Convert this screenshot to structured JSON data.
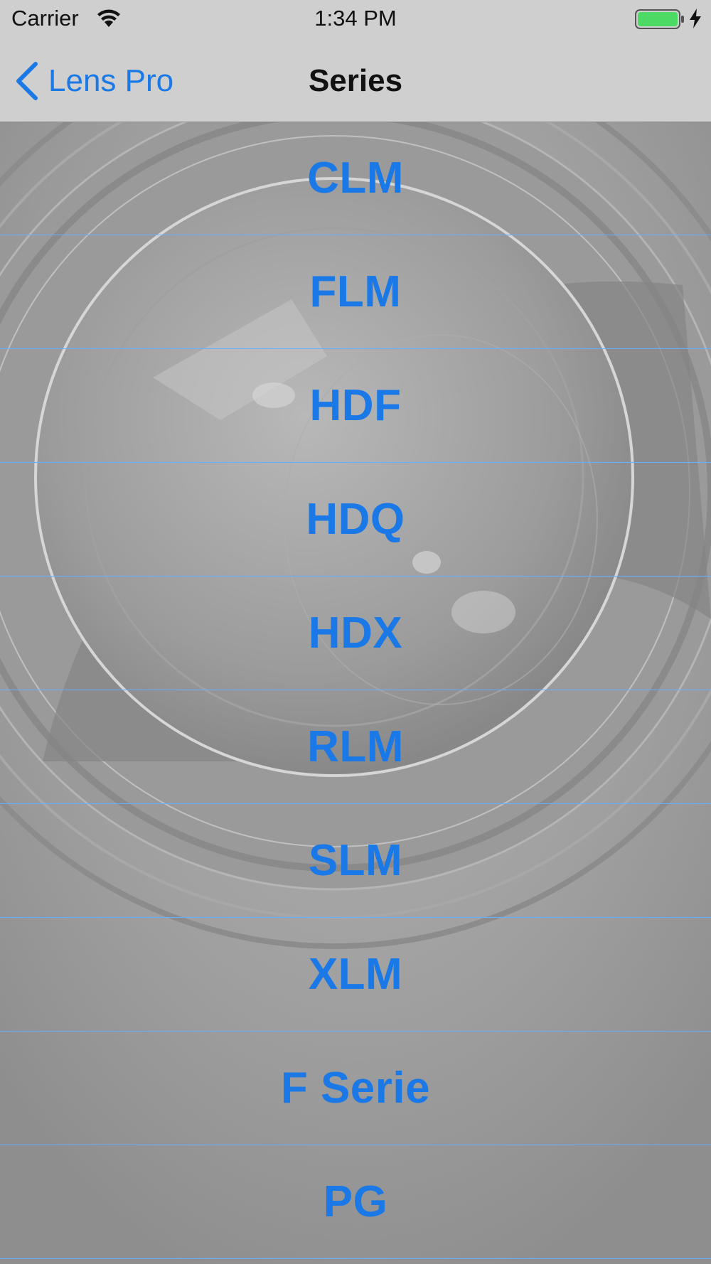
{
  "status_bar": {
    "carrier": "Carrier",
    "time": "1:34 PM",
    "icons": [
      "wifi-icon",
      "battery-icon",
      "charging-icon"
    ],
    "battery_color": "#4cd964"
  },
  "nav": {
    "back_label": "Lens Pro",
    "title": "Series",
    "accent_color": "#1a79e6"
  },
  "series": [
    {
      "label": "CLM"
    },
    {
      "label": "FLM"
    },
    {
      "label": "HDF"
    },
    {
      "label": "HDQ"
    },
    {
      "label": "HDX"
    },
    {
      "label": "RLM"
    },
    {
      "label": "SLM"
    },
    {
      "label": "XLM"
    },
    {
      "label": "F Serie"
    },
    {
      "label": "PG"
    }
  ]
}
